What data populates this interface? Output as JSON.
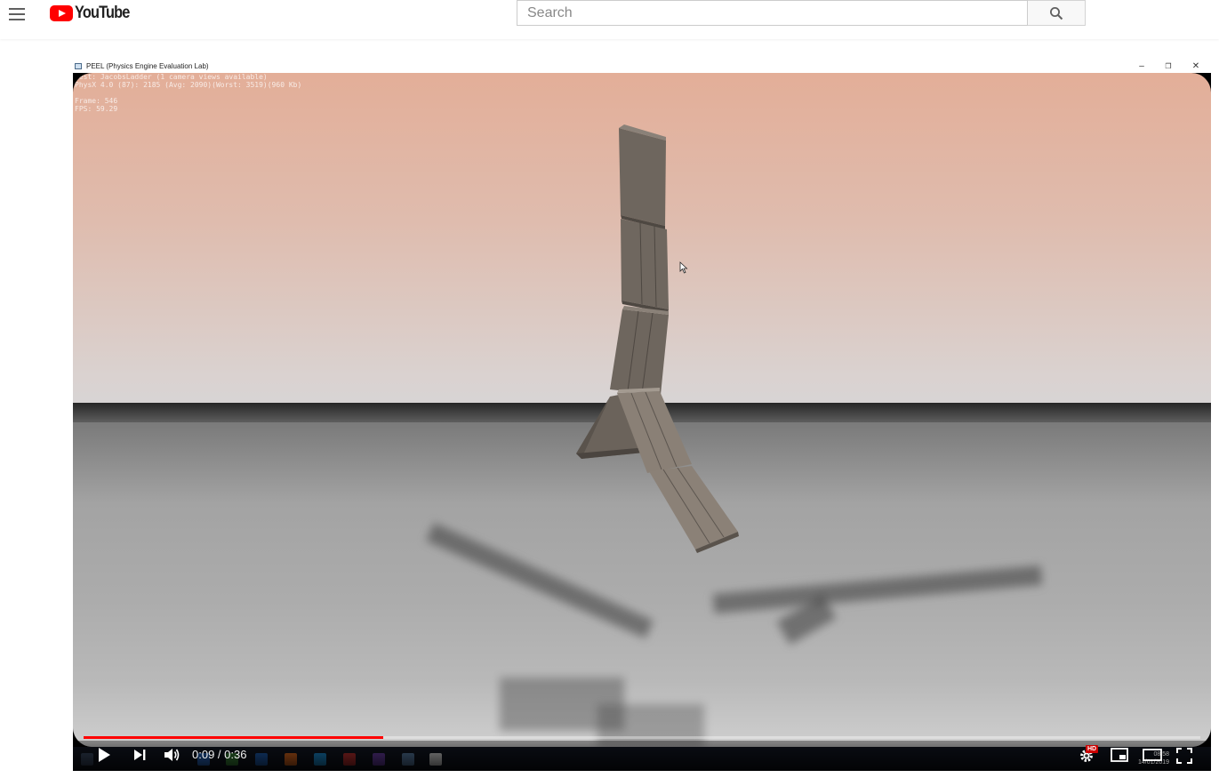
{
  "masthead": {
    "logo_text": "YouTube",
    "search_placeholder": "Search"
  },
  "video_window": {
    "title": "PEEL (Physics Engine Evaluation Lab)",
    "controls": {
      "minimize": "–",
      "restore": "❐",
      "close": "✕"
    }
  },
  "hud": {
    "line1": "Test: JacobsLadder (1 camera views available)",
    "line2": "PhysX 4.0 (87): 2185 (Avg: 2090)(Worst: 3519)(960 Kb)",
    "line3": "Frame: 546",
    "line4": "FPS: 59.29"
  },
  "player": {
    "time_display": "0:09 / 0:36",
    "progress_fraction": 0.268,
    "hd_badge": "HD",
    "tray_time": "08:58",
    "tray_date": "14/01/2019"
  },
  "colors": {
    "brand_red": "#ff0000",
    "progress_red": "#ff0000",
    "hd_badge_red": "#cc0000"
  },
  "icons": {
    "menu": "hamburger-icon",
    "search": "search-icon",
    "play": "play-icon",
    "next": "next-icon",
    "volume": "volume-icon",
    "settings": "gear-icon",
    "miniplayer": "miniplayer-icon",
    "theater": "theater-icon",
    "fullscreen": "fullscreen-icon"
  }
}
